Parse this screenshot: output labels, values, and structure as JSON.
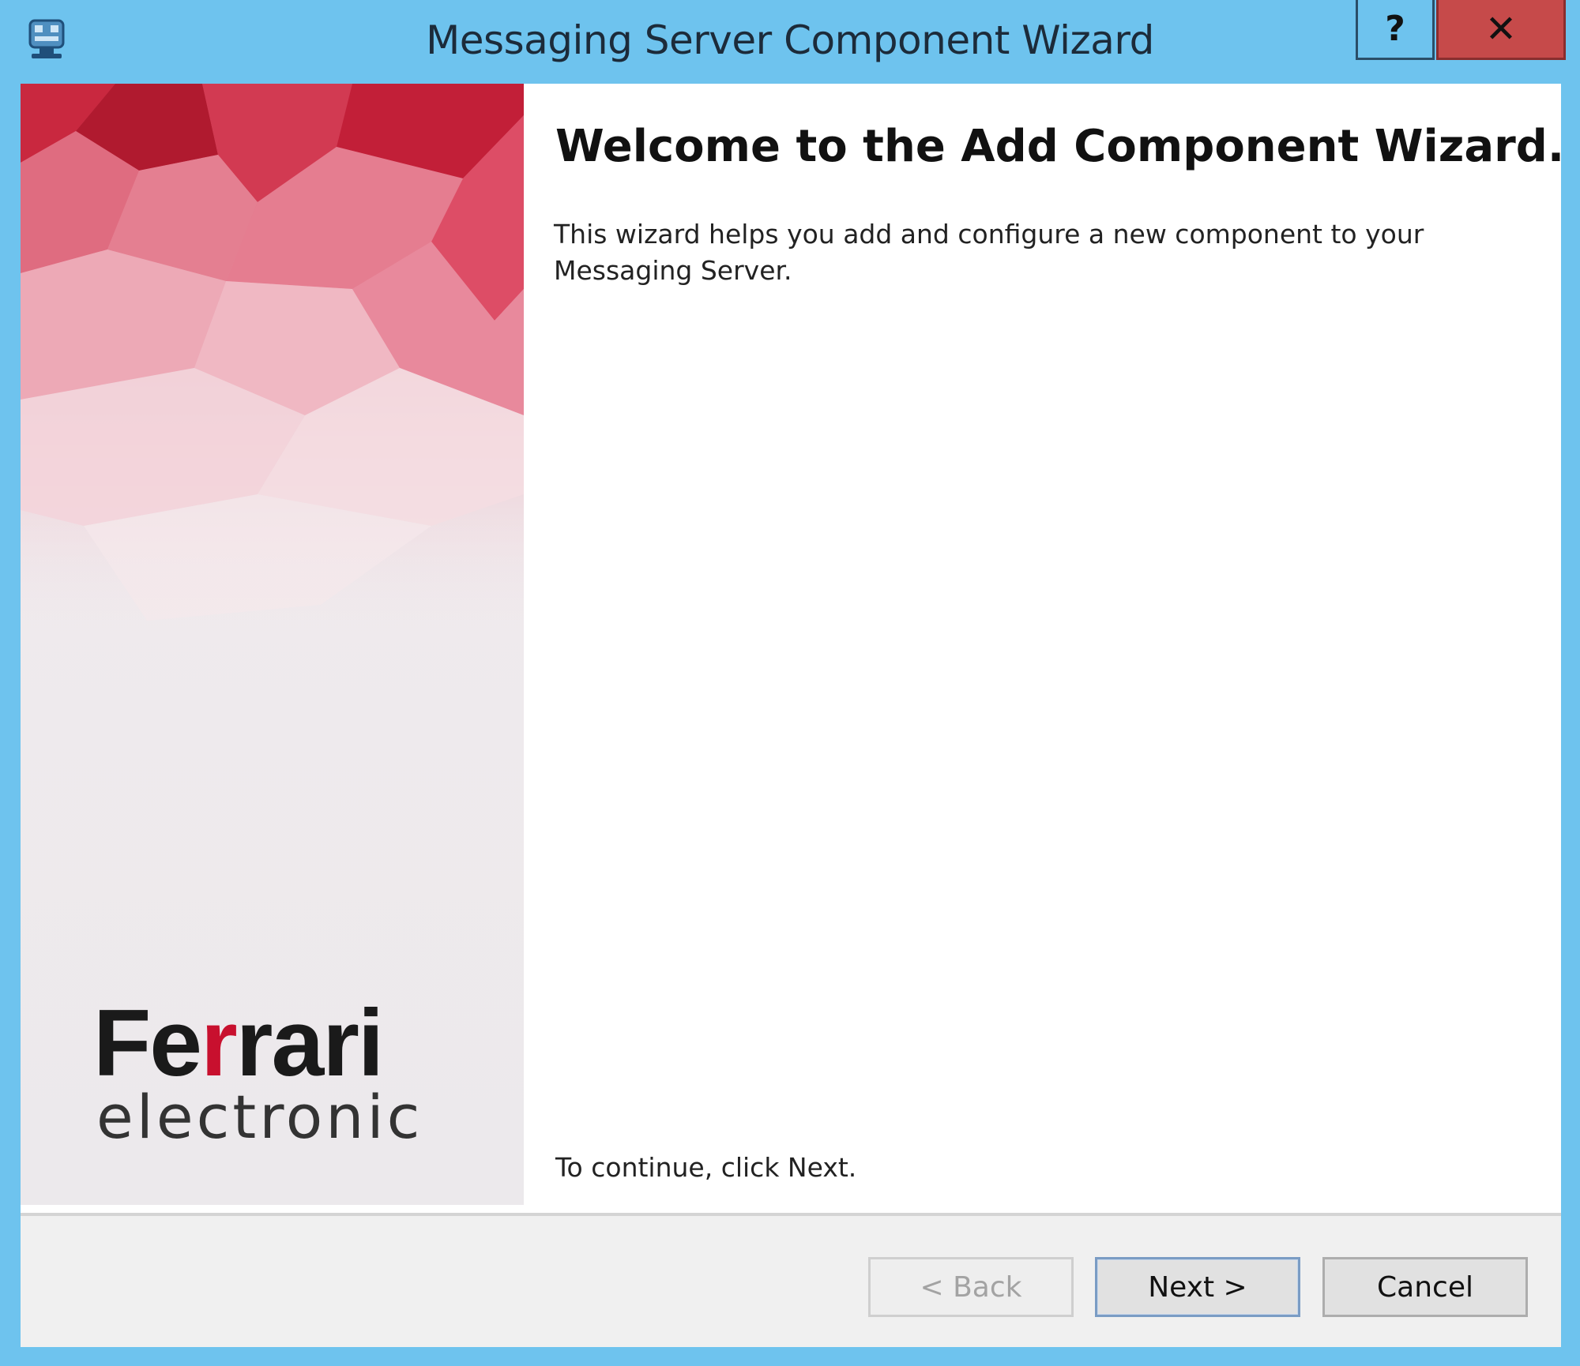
{
  "window": {
    "title": "Messaging Server Component Wizard",
    "app_icon": "server-components-icon",
    "help_label": "?",
    "close_label": "✕"
  },
  "banner": {
    "logo_text_start": "Fe",
    "logo_text_accent": "r",
    "logo_text_end": "rari",
    "logo_subtext": "electronic",
    "accent_color": "#c8102e"
  },
  "content": {
    "heading": "Welcome to the Add Component Wizard.",
    "description": "This wizard helps you add and configure a new component to your Messaging Server.",
    "continue_text": "To continue, click Next."
  },
  "buttons": {
    "back_label": "< Back",
    "back_enabled": false,
    "next_label": "Next >",
    "cancel_label": "Cancel"
  }
}
